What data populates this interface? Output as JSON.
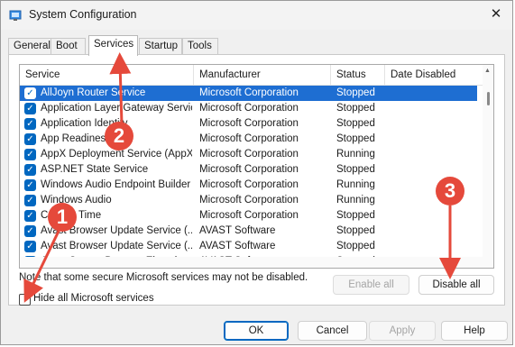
{
  "window": {
    "title": "System Configuration",
    "close_glyph": "✕"
  },
  "tabs": [
    {
      "label": "General",
      "active": false
    },
    {
      "label": "Boot",
      "active": false
    },
    {
      "label": "Services",
      "active": true
    },
    {
      "label": "Startup",
      "active": false
    },
    {
      "label": "Tools",
      "active": false
    }
  ],
  "services_table": {
    "columns": [
      "Service",
      "Manufacturer",
      "Status",
      "Date Disabled"
    ],
    "rows": [
      {
        "service": "AllJoyn Router Service",
        "manufacturer": "Microsoft Corporation",
        "status": "Stopped",
        "date_disabled": "",
        "checked": true,
        "selected": true
      },
      {
        "service": "Application Layer Gateway Service",
        "manufacturer": "Microsoft Corporation",
        "status": "Stopped",
        "date_disabled": "",
        "checked": true,
        "selected": false
      },
      {
        "service": "Application Identity",
        "manufacturer": "Microsoft Corporation",
        "status": "Stopped",
        "date_disabled": "",
        "checked": true,
        "selected": false
      },
      {
        "service": "App Readiness",
        "manufacturer": "Microsoft Corporation",
        "status": "Stopped",
        "date_disabled": "",
        "checked": true,
        "selected": false
      },
      {
        "service": "AppX Deployment Service (AppX...",
        "manufacturer": "Microsoft Corporation",
        "status": "Running",
        "date_disabled": "",
        "checked": true,
        "selected": false
      },
      {
        "service": "ASP.NET State Service",
        "manufacturer": "Microsoft Corporation",
        "status": "Stopped",
        "date_disabled": "",
        "checked": true,
        "selected": false
      },
      {
        "service": "Windows Audio Endpoint Builder",
        "manufacturer": "Microsoft Corporation",
        "status": "Running",
        "date_disabled": "",
        "checked": true,
        "selected": false
      },
      {
        "service": "Windows Audio",
        "manufacturer": "Microsoft Corporation",
        "status": "Running",
        "date_disabled": "",
        "checked": true,
        "selected": false
      },
      {
        "service": "Cellular Time",
        "manufacturer": "Microsoft Corporation",
        "status": "Stopped",
        "date_disabled": "",
        "checked": true,
        "selected": false
      },
      {
        "service": "Avast Browser Update Service (...",
        "manufacturer": "AVAST Software",
        "status": "Stopped",
        "date_disabled": "",
        "checked": true,
        "selected": false
      },
      {
        "service": "Avast Browser Update Service (...",
        "manufacturer": "AVAST Software",
        "status": "Stopped",
        "date_disabled": "",
        "checked": true,
        "selected": false
      },
      {
        "service": "Avast Secure Browser Elevation ...",
        "manufacturer": "AVAST Software",
        "status": "Stopped",
        "date_disabled": "",
        "checked": true,
        "selected": false
      }
    ]
  },
  "note": "Note that some secure Microsoft services may not be disabled.",
  "buttons": {
    "enable_all": "Enable all",
    "disable_all": "Disable all",
    "ok": "OK",
    "cancel": "Cancel",
    "apply": "Apply",
    "help": "Help"
  },
  "hide_ms_services": {
    "label": "Hide all Microsoft services",
    "checked": false
  },
  "callouts": [
    "1",
    "2",
    "3"
  ],
  "colors": {
    "selection": "#1e6ed2",
    "checkbox": "#0067c0",
    "callout": "#e5493b",
    "primary_border": "#0067c0"
  },
  "icons": {
    "app": "system-config-icon",
    "checkbox": "checkmark-icon",
    "close": "close-icon"
  }
}
